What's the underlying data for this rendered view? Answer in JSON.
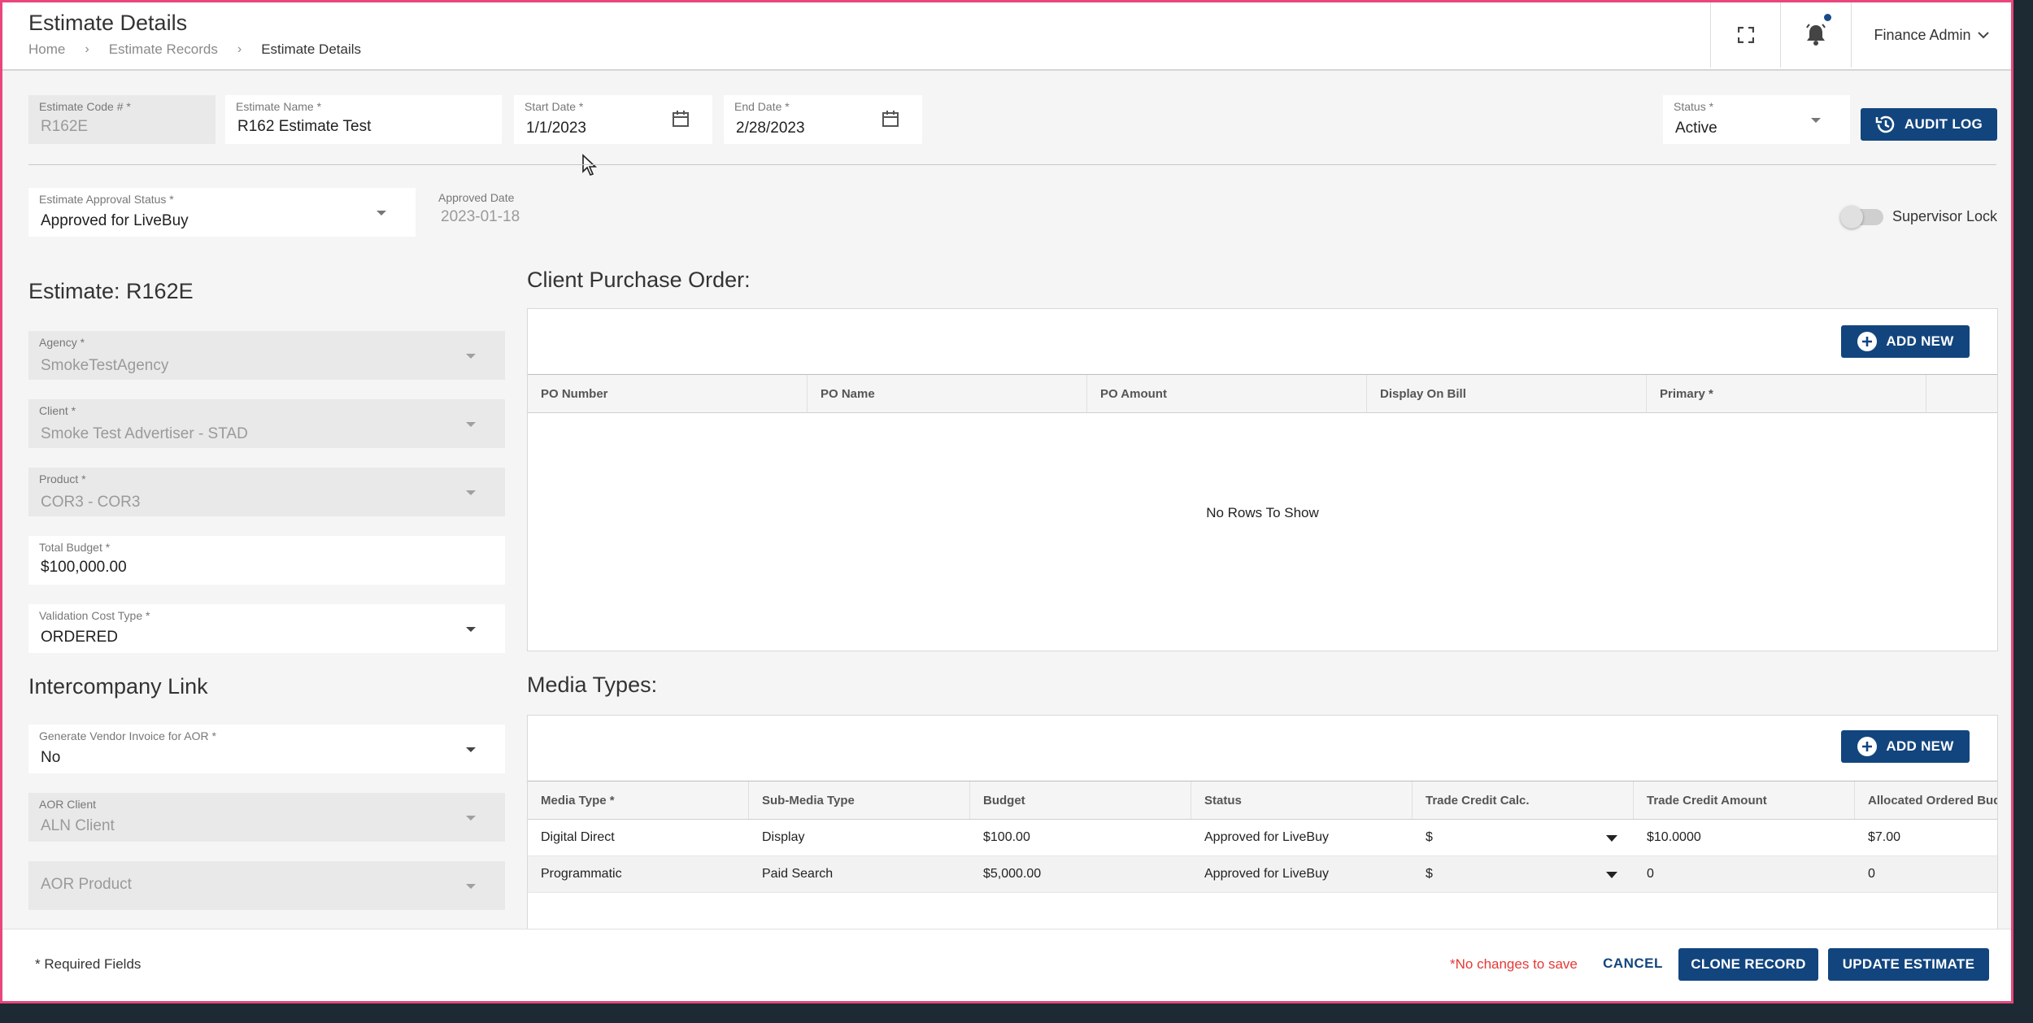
{
  "header": {
    "title": "Estimate Details",
    "breadcrumb": [
      "Home",
      "Estimate Records",
      "Estimate Details"
    ],
    "user": "Finance Admin"
  },
  "form": {
    "estimate_code": {
      "label": "Estimate Code # *",
      "value": "R162E"
    },
    "estimate_name": {
      "label": "Estimate Name *",
      "value": "R162 Estimate Test"
    },
    "start_date": {
      "label": "Start Date *",
      "value": "1/1/2023"
    },
    "end_date": {
      "label": "End Date *",
      "value": "2/28/2023"
    },
    "status": {
      "label": "Status *",
      "value": "Active"
    },
    "audit_log_label": "AUDIT LOG",
    "approval_status": {
      "label": "Estimate Approval Status *",
      "value": "Approved for LiveBuy"
    },
    "approved_date": {
      "label": "Approved Date",
      "value": "2023-01-18"
    },
    "supervisor_lock_label": "Supervisor Lock"
  },
  "estimate": {
    "title": "Estimate: R162E",
    "agency": {
      "label": "Agency *",
      "value": "SmokeTestAgency"
    },
    "client": {
      "label": "Client *",
      "value": "Smoke Test Advertiser - STAD"
    },
    "product": {
      "label": "Product *",
      "value": "COR3 - COR3"
    },
    "total_budget": {
      "label": "Total Budget *",
      "value": "$100,000.00"
    },
    "validation_cost_type": {
      "label": "Validation Cost Type *",
      "value": "ORDERED"
    }
  },
  "intercompany": {
    "title": "Intercompany Link",
    "generate_vendor_invoice": {
      "label": "Generate Vendor Invoice for AOR *",
      "value": "No"
    },
    "aor_client": {
      "label": "AOR Client",
      "value": "ALN Client"
    },
    "aor_product": {
      "placeholder": "AOR Product"
    }
  },
  "client_po": {
    "title": "Client Purchase Order:",
    "add_new_label": "ADD NEW",
    "columns": [
      "PO Number",
      "PO Name",
      "PO Amount",
      "Display On Bill",
      "Primary *"
    ],
    "empty_text": "No Rows To Show"
  },
  "media_types": {
    "title": "Media Types:",
    "add_new_label": "ADD NEW",
    "columns": [
      "Media Type *",
      "Sub-Media Type",
      "Budget",
      "Status",
      "Trade Credit Calc.",
      "Trade Credit Amount",
      "Allocated Ordered Budg"
    ],
    "rows": [
      [
        "Digital Direct",
        "Display",
        "$100.00",
        "Approved for LiveBuy",
        "$",
        "$10.0000",
        "$7.00"
      ],
      [
        "Programmatic",
        "Paid Search",
        "$5,000.00",
        "Approved for LiveBuy",
        "$",
        "0",
        "0"
      ]
    ]
  },
  "footer": {
    "required_note": "* Required Fields",
    "no_changes": "*No changes to save",
    "cancel_label": "CANCEL",
    "clone_label": "CLONE RECORD",
    "update_label": "UPDATE ESTIMATE"
  },
  "colors": {
    "primary": "#12457e",
    "accent_border": "#e8467c",
    "warning_text": "#e53935"
  }
}
